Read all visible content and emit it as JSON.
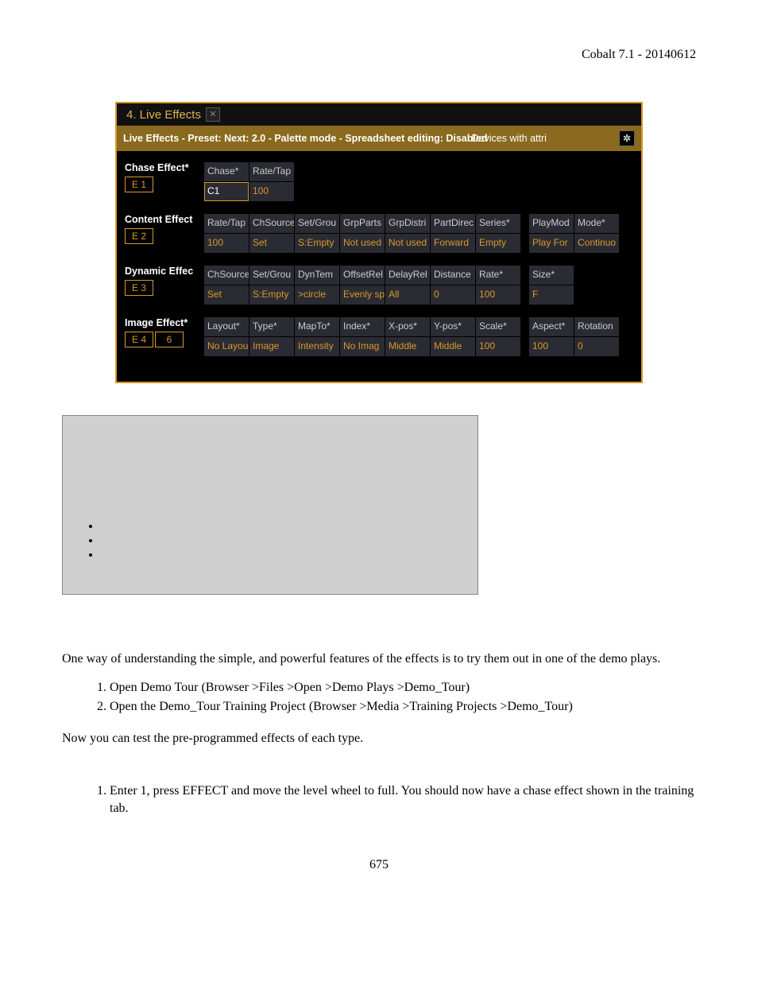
{
  "doc": {
    "header": "Cobalt 7.1 - 20140612",
    "page_number": "675",
    "para1": "One way of understanding the simple, and powerful features of the effects is to try them out in one of the demo plays.",
    "steps1": [
      "Open Demo Tour (Browser >Files >Open >Demo Plays >Demo_Tour)",
      "Open the Demo_Tour Training Project (Browser >Media >Training Projects >Demo_Tour)"
    ],
    "para2": "Now you can test the pre-programmed effects of each type.",
    "steps2": [
      "Enter 1, press EFFECT and move the level wheel to full. You should now have a chase effect shown in the training tab."
    ]
  },
  "app": {
    "tab_title": "4. Live Effects",
    "infobar_main": "Live Effects - Preset:  Next: 2.0 - Palette mode - Spreadsheet editing: Disabled",
    "infobar_right": "Devices with attri",
    "rows": [
      {
        "label": "Chase Effect*",
        "e": [
          "E 1"
        ],
        "cols": [
          {
            "h": "Chase*",
            "v": "C1",
            "sel": true
          },
          {
            "h": "Rate/Tap",
            "v": "100"
          }
        ]
      },
      {
        "label": "Content Effect",
        "e": [
          "E 2"
        ],
        "cols": [
          {
            "h": "Rate/Tap",
            "v": "100"
          },
          {
            "h": "ChSource",
            "v": "Set"
          },
          {
            "h": "Set/Grou",
            "v": "S:Empty"
          },
          {
            "h": "GrpParts",
            "v": "Not used"
          },
          {
            "h": "GrpDistri",
            "v": "Not used"
          },
          {
            "h": "PartDirec",
            "v": "Forward"
          },
          {
            "h": "Series*",
            "v": "Empty"
          }
        ],
        "tail": [
          {
            "h": "PlayMod",
            "v": "Play For"
          },
          {
            "h": "Mode*",
            "v": "Continuo"
          }
        ]
      },
      {
        "label": "Dynamic Effec",
        "e": [
          "E 3"
        ],
        "cols": [
          {
            "h": "ChSource",
            "v": "Set"
          },
          {
            "h": "Set/Grou",
            "v": "S:Empty"
          },
          {
            "h": "DynTem",
            "v": ">circle"
          },
          {
            "h": "OffsetRel",
            "v": "Evenly sp"
          },
          {
            "h": "DelayRel",
            "v": "All"
          },
          {
            "h": "Distance",
            "v": "0"
          },
          {
            "h": "Rate*",
            "v": "100"
          }
        ],
        "tail": [
          {
            "h": "Size*",
            "v": "F"
          }
        ]
      },
      {
        "label": "Image Effect*",
        "e": [
          "E 4",
          "6"
        ],
        "cols": [
          {
            "h": "Layout*",
            "v": "No Layou"
          },
          {
            "h": "Type*",
            "v": "Image"
          },
          {
            "h": "MapTo*",
            "v": "Intensity"
          },
          {
            "h": "Index*",
            "v": "No Imag"
          },
          {
            "h": "X-pos*",
            "v": "Middle"
          },
          {
            "h": "Y-pos*",
            "v": "Middle"
          },
          {
            "h": "Scale*",
            "v": "100"
          }
        ],
        "tail": [
          {
            "h": "Aspect*",
            "v": "100"
          },
          {
            "h": "Rotation",
            "v": "0"
          }
        ]
      }
    ]
  }
}
